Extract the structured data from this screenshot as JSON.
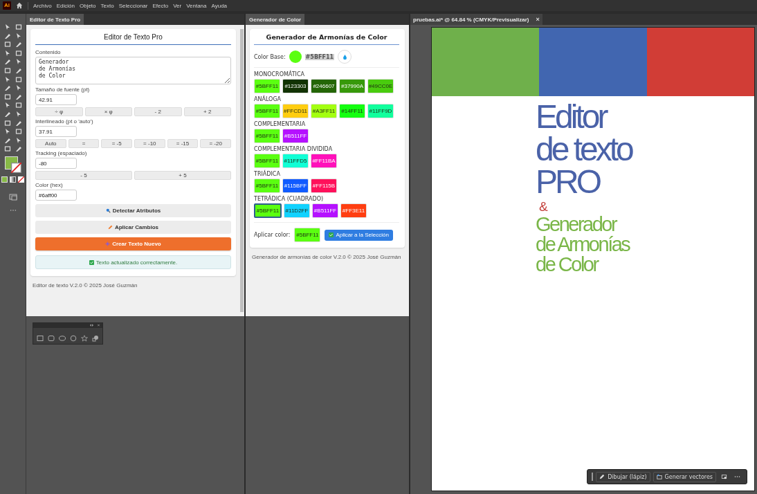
{
  "menu_bar": {
    "logo": "Ai",
    "items": [
      "Archivo",
      "Edición",
      "Objeto",
      "Texto",
      "Seleccionar",
      "Efecto",
      "Ver",
      "Ventana",
      "Ayuda"
    ]
  },
  "text_editor_panel": {
    "tab": "Editor de Texto Pro",
    "title": "Editor de Texto Pro",
    "content": {
      "label": "Contenido",
      "value": "Generador\nde Armonías\nde Color"
    },
    "font_size": {
      "label": "Tamaño de fuente (pt)",
      "value": "42.91",
      "buttons": [
        "÷ φ",
        "× φ",
        "- 2",
        "+ 2"
      ]
    },
    "leading": {
      "label": "Interlineado (pt o 'auto')",
      "value": "37.91",
      "buttons": [
        "Auto",
        "=",
        "= -5",
        "= -10",
        "= -15",
        "= -20"
      ]
    },
    "tracking": {
      "label": "Tracking (espaciado)",
      "value": "-80",
      "buttons": [
        "- 5",
        "+ 5"
      ]
    },
    "color": {
      "label": "Color (hex)",
      "value": "#6aff00"
    },
    "detect_button": "Detectar Atributos",
    "apply_button": "Aplicar Cambios",
    "create_button": "Crear Texto Nuevo",
    "status_message": "Texto actualizado correctamente.",
    "footer": "Editor de texto V.2.0 © 2025 José Guzmán"
  },
  "color_panel": {
    "tab": "Generador de Color",
    "title": "Generador de Armonías de Color",
    "base": {
      "label": "Color Base:",
      "color": "#5bff11",
      "hex": "#5BFF11"
    },
    "harmonies": [
      {
        "name": "MONOCROMÁTICA",
        "swatches": [
          {
            "label": "#5BFF11",
            "color": "#5bff11",
            "selected": false
          },
          {
            "label": "#123303",
            "color": "#123303",
            "selected": false
          },
          {
            "label": "#246607",
            "color": "#246607",
            "selected": false
          },
          {
            "label": "#37990A",
            "color": "#37990a",
            "selected": false
          },
          {
            "label": "#49CC0E",
            "color": "#49cc0e",
            "selected": false
          }
        ]
      },
      {
        "name": "ANÁLOGA",
        "swatches": [
          {
            "label": "#5BFF11",
            "color": "#5bff11",
            "selected": false
          },
          {
            "label": "#FFCD11",
            "color": "#ffcd11",
            "selected": false
          },
          {
            "label": "#A3FF11",
            "color": "#a3ff11",
            "selected": false
          },
          {
            "label": "#14FF11",
            "color": "#14ff11",
            "selected": false
          },
          {
            "label": "#11FF9D",
            "color": "#11ff9d",
            "selected": false
          }
        ]
      },
      {
        "name": "COMPLEMENTARIA",
        "swatches": [
          {
            "label": "#5BFF11",
            "color": "#5bff11",
            "selected": false
          },
          {
            "label": "#B511FF",
            "color": "#b511ff",
            "selected": false
          }
        ]
      },
      {
        "name": "COMPLEMENTARIA DIVIDIDA",
        "swatches": [
          {
            "label": "#5BFF11",
            "color": "#5bff11",
            "selected": false
          },
          {
            "label": "#11FFD5",
            "color": "#11ffd5",
            "selected": false
          },
          {
            "label": "#FF11BA",
            "color": "#ff11ba",
            "selected": false
          }
        ]
      },
      {
        "name": "TRIÁDICA",
        "swatches": [
          {
            "label": "#5BFF11",
            "color": "#5bff11",
            "selected": false
          },
          {
            "label": "#115BFF",
            "color": "#115bff",
            "selected": false
          },
          {
            "label": "#FF115B",
            "color": "#ff115b",
            "selected": false
          }
        ]
      },
      {
        "name": "TETRÁDICA (CUADRADO)",
        "swatches": [
          {
            "label": "#5BFF11",
            "color": "#5bff11",
            "selected": true
          },
          {
            "label": "#11D2FF",
            "color": "#11d2ff",
            "selected": false
          },
          {
            "label": "#B511FF",
            "color": "#b511ff",
            "selected": false
          },
          {
            "label": "#FF3E11",
            "color": "#ff3e11",
            "selected": false
          }
        ]
      }
    ],
    "apply": {
      "label": "Aplicar color:",
      "swatch_label": "#5BFF11",
      "color": "#5bff11",
      "button": "Aplicar a la Selección"
    },
    "footer": "Generador de armonías de color V.2.0 © 2025 José Guzmán"
  },
  "document": {
    "tab": "pruebas.ai* @ 64.84 % (CMYK/Previsualizar)",
    "close": "×",
    "color_bars": [
      {
        "color": "#6fb04b"
      },
      {
        "color": "#4166b0"
      },
      {
        "color": "#d13d36"
      }
    ],
    "headline": [
      "Editor",
      "de texto",
      "PRO"
    ],
    "ampersand": "&",
    "subtitle": [
      "Generador",
      "de Armonías",
      "de Color"
    ]
  },
  "context_bar": {
    "draw_button": "Dibujar (lápiz)",
    "vectors_button": "Generar vectores"
  }
}
